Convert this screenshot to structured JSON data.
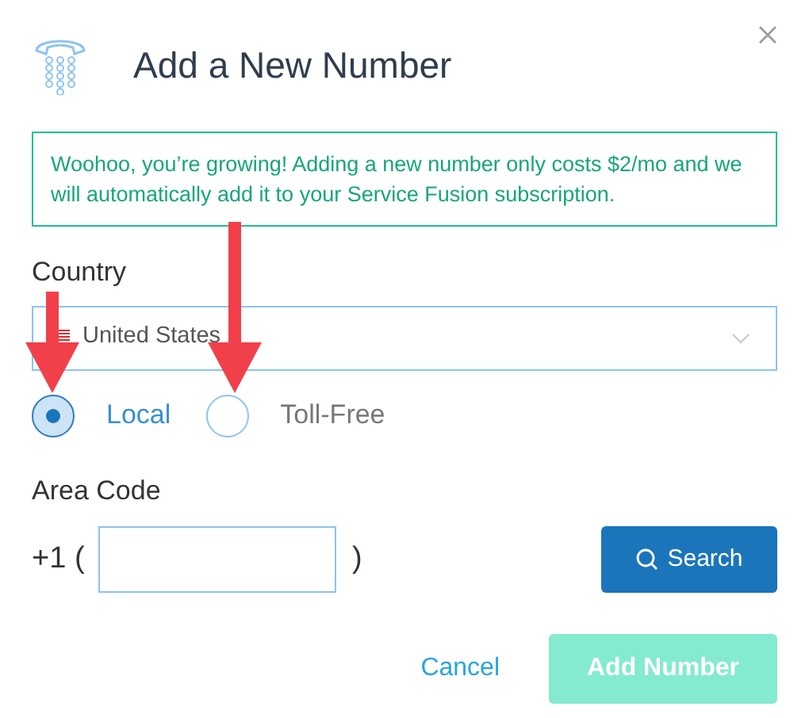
{
  "dialog": {
    "title": "Add a New Number"
  },
  "banner": {
    "text": "Woohoo, you’re growing! Adding a new number only costs $2/mo and we will automatically add it to your Service Fusion subscription."
  },
  "country": {
    "label": "Country",
    "value": "United States"
  },
  "number_type": [
    {
      "label": "Local",
      "selected": true
    },
    {
      "label": "Toll-Free",
      "selected": false
    }
  ],
  "area_code": {
    "label": "Area Code",
    "prefix": "+1 (",
    "suffix": ")"
  },
  "search_button": {
    "label": "Search"
  },
  "buttons": [
    {
      "kind": "link",
      "label": "Cancel",
      "disabled": false
    },
    {
      "kind": "primary",
      "label": "Add Number",
      "disabled": true
    }
  ]
}
